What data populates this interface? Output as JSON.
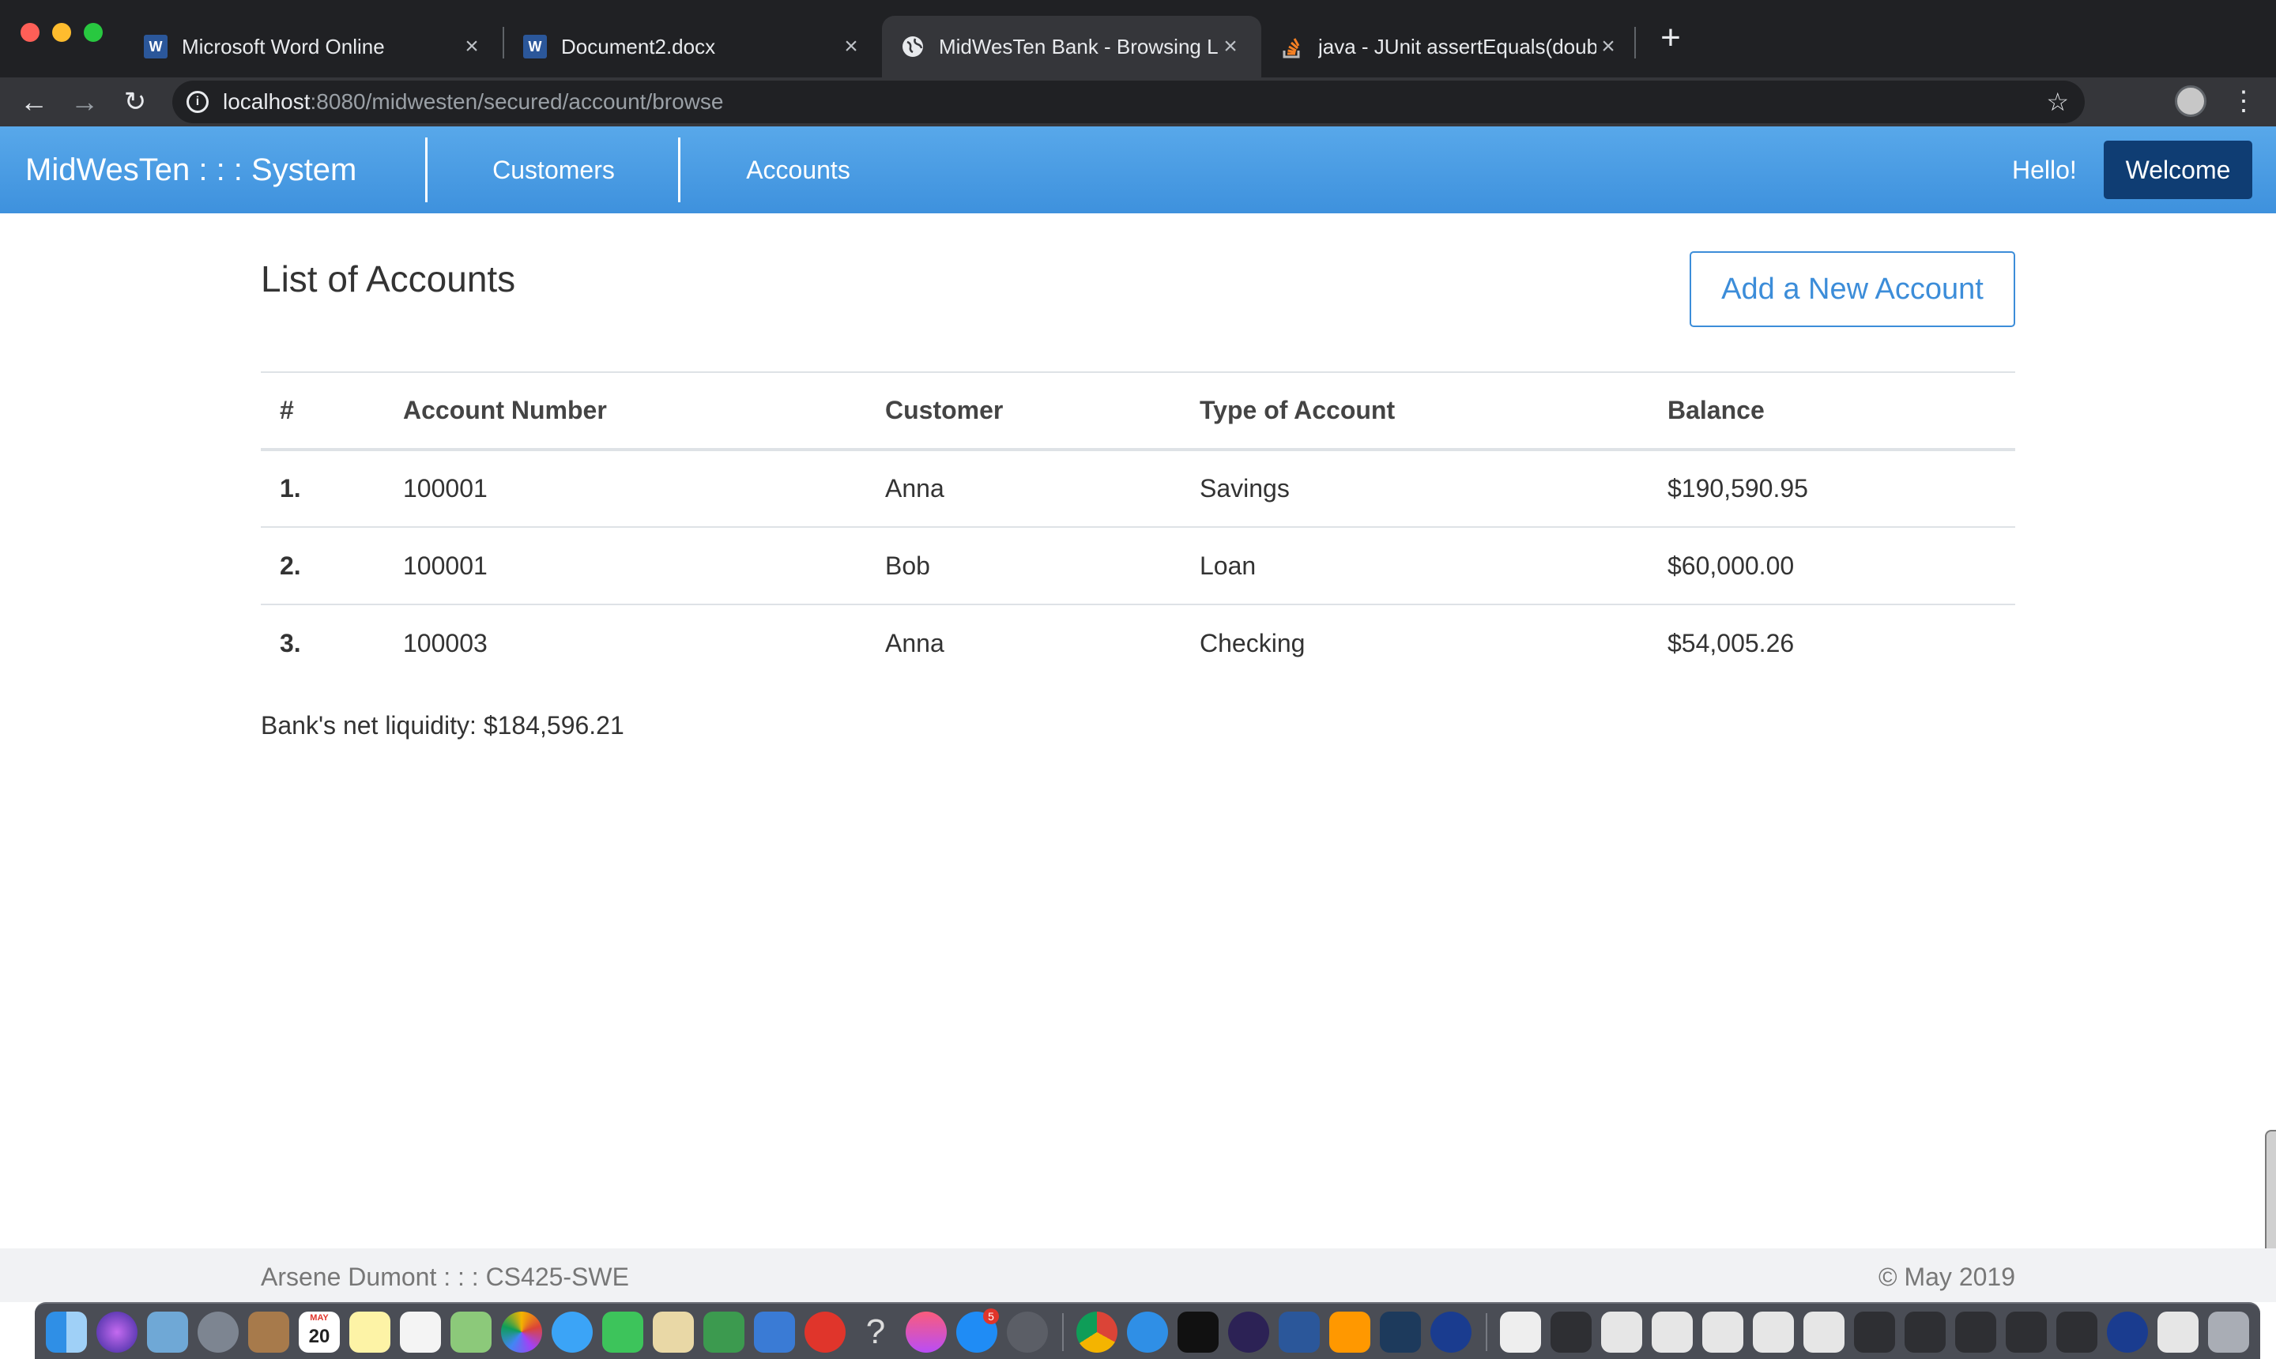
{
  "browser": {
    "tabs": [
      {
        "title": "Microsoft Word Online",
        "icon": "word-icon",
        "active": false
      },
      {
        "title": "Document2.docx",
        "icon": "word-icon",
        "active": false
      },
      {
        "title": "MidWesTen Bank - Browsing Li",
        "icon": "globe-icon",
        "active": true
      },
      {
        "title": "java - JUnit assertEquals(doub",
        "icon": "stackoverflow-icon",
        "active": false
      }
    ],
    "new_tab": "+",
    "url_host": "localhost",
    "url_path": ":8080/midwesten/secured/account/browse",
    "info_icon": "i"
  },
  "navbar": {
    "brand": "MidWesTen : : : System",
    "links": [
      "Customers",
      "Accounts"
    ],
    "greeting": "Hello!",
    "welcome_button": "Welcome",
    "color": "#4a9fe6"
  },
  "page": {
    "title": "List of Accounts",
    "add_button": "Add a New Account",
    "table": {
      "headers": [
        "#",
        "Account Number",
        "Customer",
        "Type of Account",
        "Balance"
      ],
      "rows": [
        [
          "1.",
          "100001",
          "Anna",
          "Savings",
          "$190,590.95"
        ],
        [
          "2.",
          "100001",
          "Bob",
          "Loan",
          "$60,000.00"
        ],
        [
          "3.",
          "100003",
          "Anna",
          "Checking",
          "$54,005.26"
        ]
      ]
    },
    "liquidity_label": "Bank's net liquidity:",
    "liquidity_value": "$184,596.21"
  },
  "footer": {
    "left": "Arsene Dumont : : : CS425-SWE",
    "right": "© May 2019"
  },
  "dock": {
    "calendar_month": "MAY",
    "calendar_day": "20",
    "appstore_badge": "5",
    "help_glyph": "?"
  }
}
